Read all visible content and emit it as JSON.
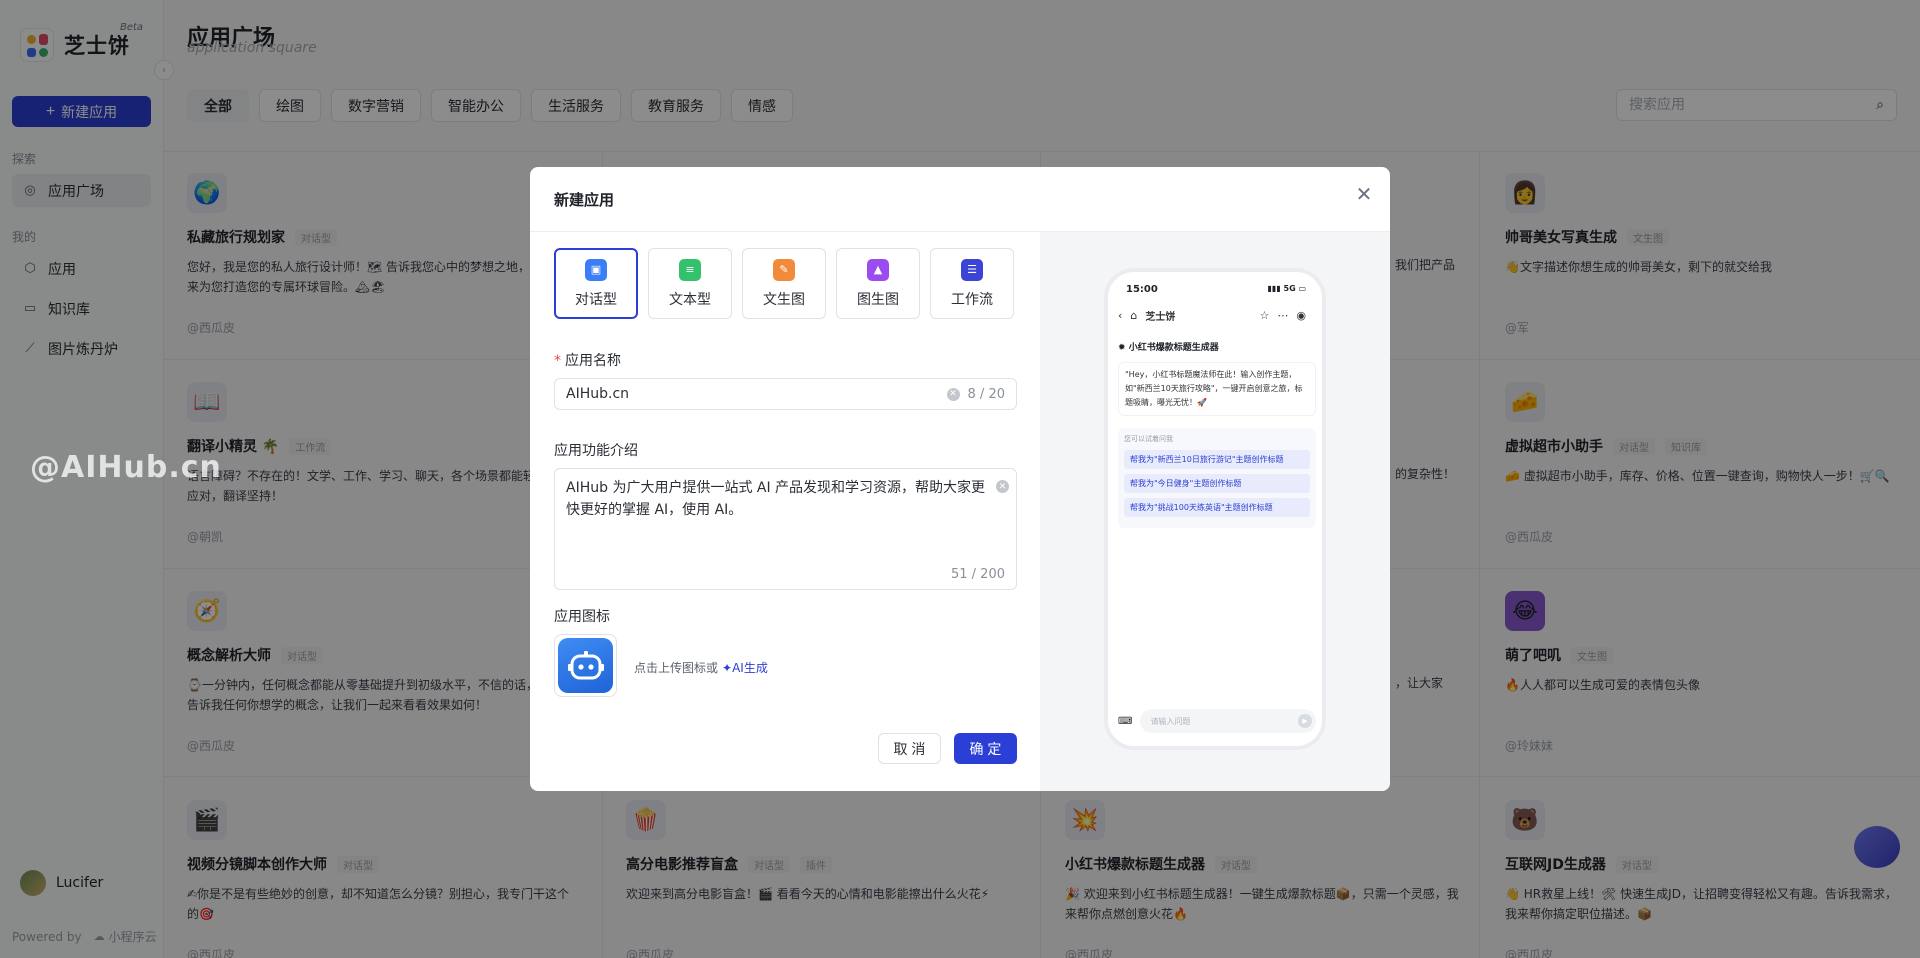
{
  "sidebar": {
    "logo_text": "芝士饼",
    "beta": "Beta",
    "collapse_icon": "‹",
    "new_app_label": "新建应用",
    "explore_label": "探索",
    "app_plaza_label": "应用广场",
    "mine_label": "我的",
    "apps_label": "应用",
    "knowledge_label": "知识库",
    "image_forge_label": "图片炼丹炉",
    "user_name": "Lucifer",
    "powered_by": "Powered by",
    "powered_brand": "小程序云"
  },
  "header": {
    "title": "应用广场",
    "subtitle": "application square",
    "search_placeholder": "搜索应用"
  },
  "categories": [
    "全部",
    "绘图",
    "数字营销",
    "智能办公",
    "生活服务",
    "教育服务",
    "情感"
  ],
  "cards": [
    {
      "icon": "🌍",
      "title": "私藏旅行规划家",
      "tag1": "对话型",
      "tag2": "",
      "desc": "您好，我是您的私人旅行设计师！🗺 告诉我您心中的梦想之地，我来为您打造您的专属环球冒险。🏔🏖",
      "author": "@西瓜皮"
    },
    {
      "icon": "👩",
      "title": "帅哥美女写真生成",
      "tag1": "文生图",
      "tag2": "",
      "desc": "👋文字描述你想生成的帅哥美女，剩下的就交给我",
      "author": "@军"
    },
    {
      "icon": "📖",
      "title": "翻译小精灵 🌴",
      "tag1": "工作流",
      "tag2": "",
      "desc": "语言障碍？不存在的！文学、工作、学习、聊天，各个场景都能轻松应对，翻译坚持！",
      "author": "@朝凯"
    },
    {
      "icon": "🧀",
      "title": "虚拟超市小助手",
      "tag1": "对话型",
      "tag2": "知识库",
      "desc": "🧀 虚拟超市小助手，库存、价格、位置一键查询，购物快人一步！🛒🔍",
      "author": "@西瓜皮"
    },
    {
      "icon": "🧭",
      "title": "概念解析大师",
      "tag1": "对话型",
      "tag2": "",
      "desc": "⌚一分钟内，任何概念都能从零基础提升到初级水平，不信的话，告诉我任何你想学的概念，让我们一起来看看效果如何！",
      "author": "@西瓜皮"
    },
    {
      "icon": "😂",
      "title": "萌了吧叽",
      "tag1": "文生图",
      "tag2": "",
      "desc": "🔥人人都可以生成可爱的表情包头像",
      "author": "@玲妹妹"
    },
    {
      "icon": "🎬",
      "title": "视频分镜脚本创作大师",
      "tag1": "对话型",
      "tag2": "",
      "desc": "✍你是不是有些绝妙的创意，却不知道怎么分镜？别担心，我专门干这个的🎯",
      "author": "@西瓜皮"
    },
    {
      "icon": "🍿",
      "title": "高分电影推荐盲盒",
      "tag1": "对话型",
      "tag2": "插件",
      "desc": "欢迎来到高分电影盲盒！🎬 看看今天的心情和电影能擦出什么火花⚡",
      "author": "@西瓜皮"
    },
    {
      "icon": "💥",
      "title": "小红书爆款标题生成器",
      "tag1": "对话型",
      "tag2": "",
      "desc": "🎉 欢迎来到小红书标题生成器！一键生成爆款标题📦，只需一个灵感，我来帮你点燃创意火花🔥",
      "author": "@西瓜皮"
    },
    {
      "icon": "🐻",
      "title": "互联网JD生成器",
      "tag1": "对话型",
      "tag2": "",
      "desc": "👋 HR救星上线！🛠 快速生成JD，让招聘变得轻松又有趣。告诉我需求，我来帮你搞定职位描述。📦",
      "author": "@西瓜皮"
    }
  ],
  "partial_texts": {
    "row1_col3_tail": "我们把产品",
    "row2_col3_tail": "的复杂性！",
    "row3_col3_tail": "，让大家"
  },
  "watermark": "@AIHub.cn",
  "modal": {
    "title": "新建应用",
    "close_icon": "✕",
    "types": [
      {
        "label": "对话型",
        "color": "#3b7ef7",
        "icon": "chat-icon"
      },
      {
        "label": "文本型",
        "color": "#33c26b",
        "icon": "text-icon"
      },
      {
        "label": "文生图",
        "color": "#f28a3b",
        "icon": "pen-icon"
      },
      {
        "label": "图生图",
        "color": "#9a4cf0",
        "icon": "image-icon"
      },
      {
        "label": "工作流",
        "color": "#3b44d6",
        "icon": "workflow-icon"
      }
    ],
    "name_label": "应用名称",
    "required_mark": "*",
    "name_value": "AIHub.cn",
    "name_counter": "8 / 20",
    "desc_label": "应用功能介绍",
    "desc_value": "AIHub 为广大用户提供一站式 AI 产品发现和学习资源，帮助大家更快更好的掌握 AI，使用 AI。",
    "desc_counter": "51 / 200",
    "icon_label": "应用图标",
    "icon_hint": "点击上传图标或",
    "ai_generate": "✦AI生成",
    "cancel_label": "取 消",
    "ok_label": "确 定"
  },
  "phone": {
    "time": "15:00",
    "signal": "5G",
    "brand": "芝士饼",
    "bot_title": "小红书爆款标题生成器",
    "greeting": "\"Hey，小红书标题魔法师在此！输入创作主题，如\"新西兰10天旅行攻略\"，一键开启创意之旅，标题吸睛，曝光无忧！🚀",
    "suggest_title": "您可以试着问我",
    "suggestions": [
      "帮我为\"新西兰10日旅行游记\"主题创作标题",
      "帮我为\"今日健身\"主题创作标题",
      "帮我为\"挑战100天练英语\"主题创作标题"
    ],
    "input_placeholder": "请输入问题"
  }
}
